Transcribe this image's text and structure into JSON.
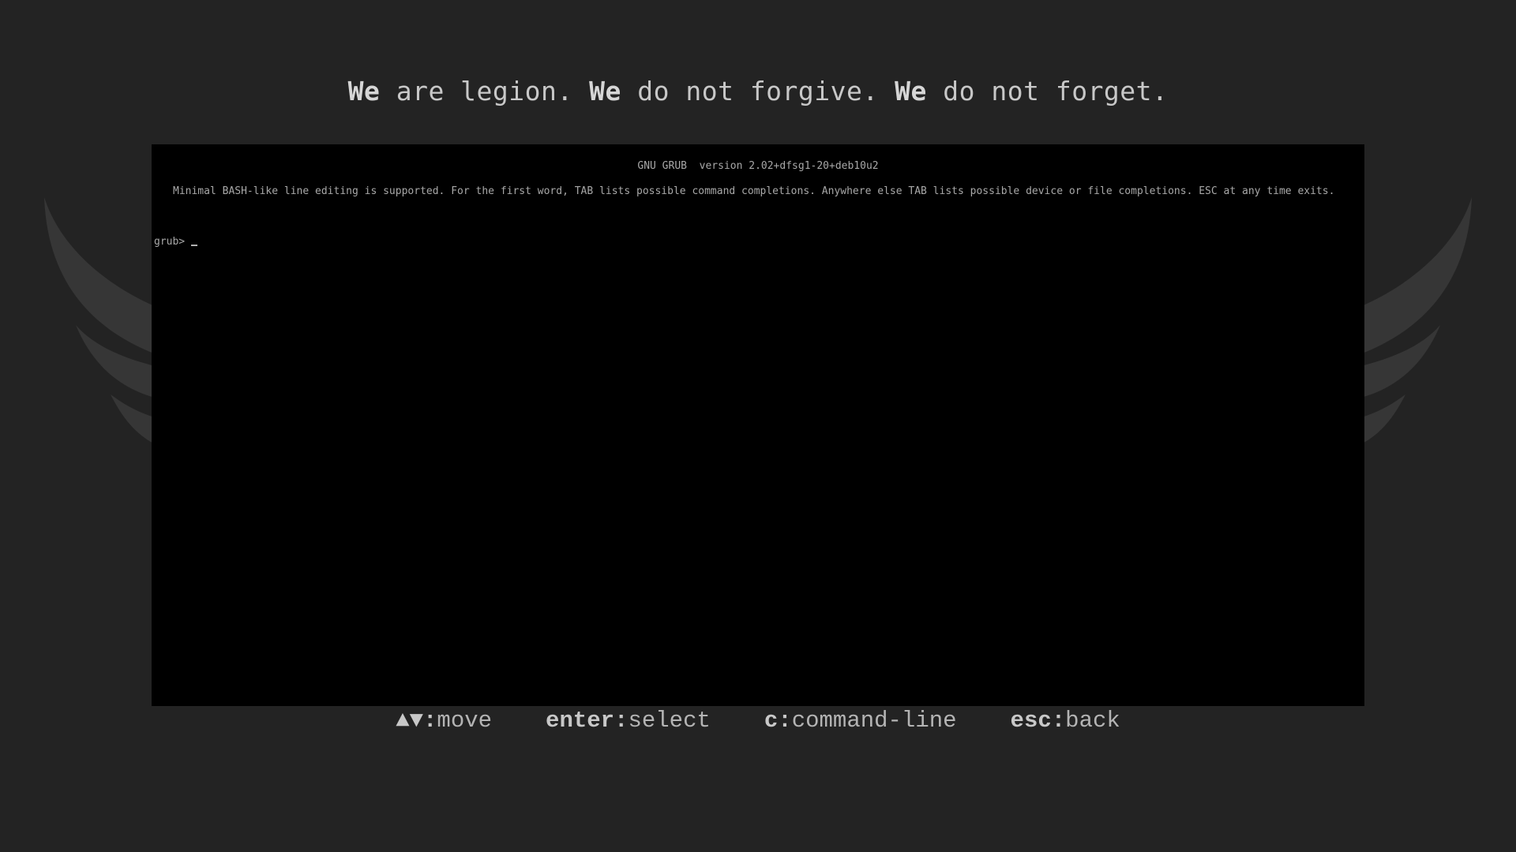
{
  "motto": {
    "part1_bold": "We",
    "part1_rest": " are legion. ",
    "part2_bold": "We",
    "part2_rest": " do not forgive. ",
    "part3_bold": "We",
    "part3_rest": " do not forget."
  },
  "terminal": {
    "header": "GNU GRUB  version 2.02+dfsg1-20+deb10u2",
    "help_text": "Minimal BASH-like line editing is supported. For the first word, TAB lists possible command completions. Anywhere else TAB lists possible device or file completions. ESC at any time exits.",
    "prompt": "grub>",
    "input_value": ""
  },
  "footer": {
    "hints": [
      {
        "key": "▲▼:",
        "action": "move"
      },
      {
        "key": "enter:",
        "action": "select"
      },
      {
        "key": "c:",
        "action": "command-line"
      },
      {
        "key": "esc:",
        "action": "back"
      }
    ]
  },
  "colors": {
    "background": "#232323",
    "terminal_bg": "#000000",
    "terminal_text": "#a8a8a8",
    "wing": "#3a3a3a"
  },
  "icons": {
    "background_art": "winged-emblem-icon"
  }
}
